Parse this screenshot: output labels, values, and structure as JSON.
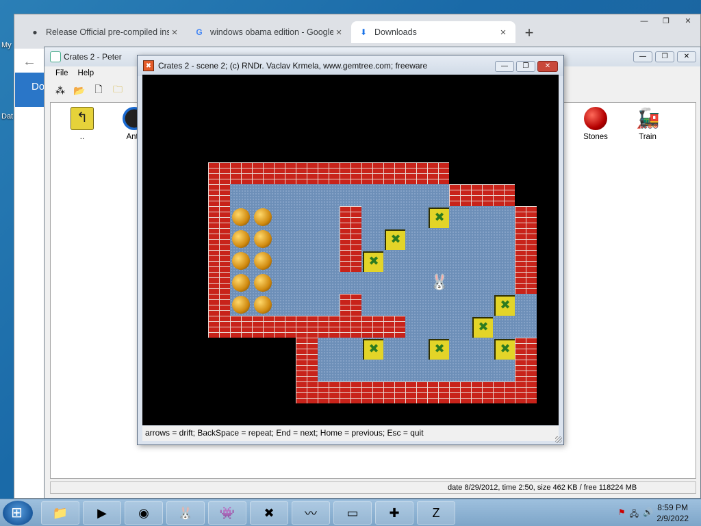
{
  "desktop": {
    "labels": [
      "My",
      "Dat"
    ]
  },
  "chrome": {
    "tabs": [
      {
        "title": "Release Official pre-compiled ins",
        "icon": "github-icon"
      },
      {
        "title": "windows obama edition - Google",
        "icon": "google-icon"
      },
      {
        "title": "Downloads",
        "icon": "download-icon",
        "active": true
      }
    ],
    "new_tab": "+",
    "sidebar_text": "Do"
  },
  "peter": {
    "title": "Crates 2 - Peter",
    "menu": [
      "File",
      "Help"
    ],
    "icons": [
      {
        "label": "..",
        "icon": "folder-up-icon"
      },
      {
        "label": "Ants",
        "icon": "ants-icon"
      },
      {
        "label": "Stones",
        "icon": "stones-icon"
      },
      {
        "label": "Train",
        "icon": "train-icon"
      }
    ],
    "status": "date 8/29/2012, time 2:50, size 462 KB / free 118224 MB"
  },
  "crates": {
    "title": "Crates 2 - scene 2;   (c) RNDr. Vaclav Krmela, www.gemtree.com;   freeware",
    "status": "arrows = drift;   BackSpace = repeat;   End = next;   Home = previous;   Esc = quit",
    "level": [
      "###########...",
      "#..........###",
      "#bb...#...c...#",
      "#bb...#.c.....#",
      "#bb...#c......#",
      "#bb.......@...#",
      "#bb...#......c.",
      "#########...c..",
      "....#..c..c..c#",
      "....#.........#",
      "....###########"
    ]
  },
  "taskbar": {
    "items": [
      "explorer",
      "media-player",
      "chrome",
      "crates-bunny",
      "alien",
      "yellow-x",
      "oscilloscope",
      "cmd",
      "puzzle",
      "crates-2"
    ],
    "time": "8:59 PM",
    "date": "2/9/2022"
  }
}
